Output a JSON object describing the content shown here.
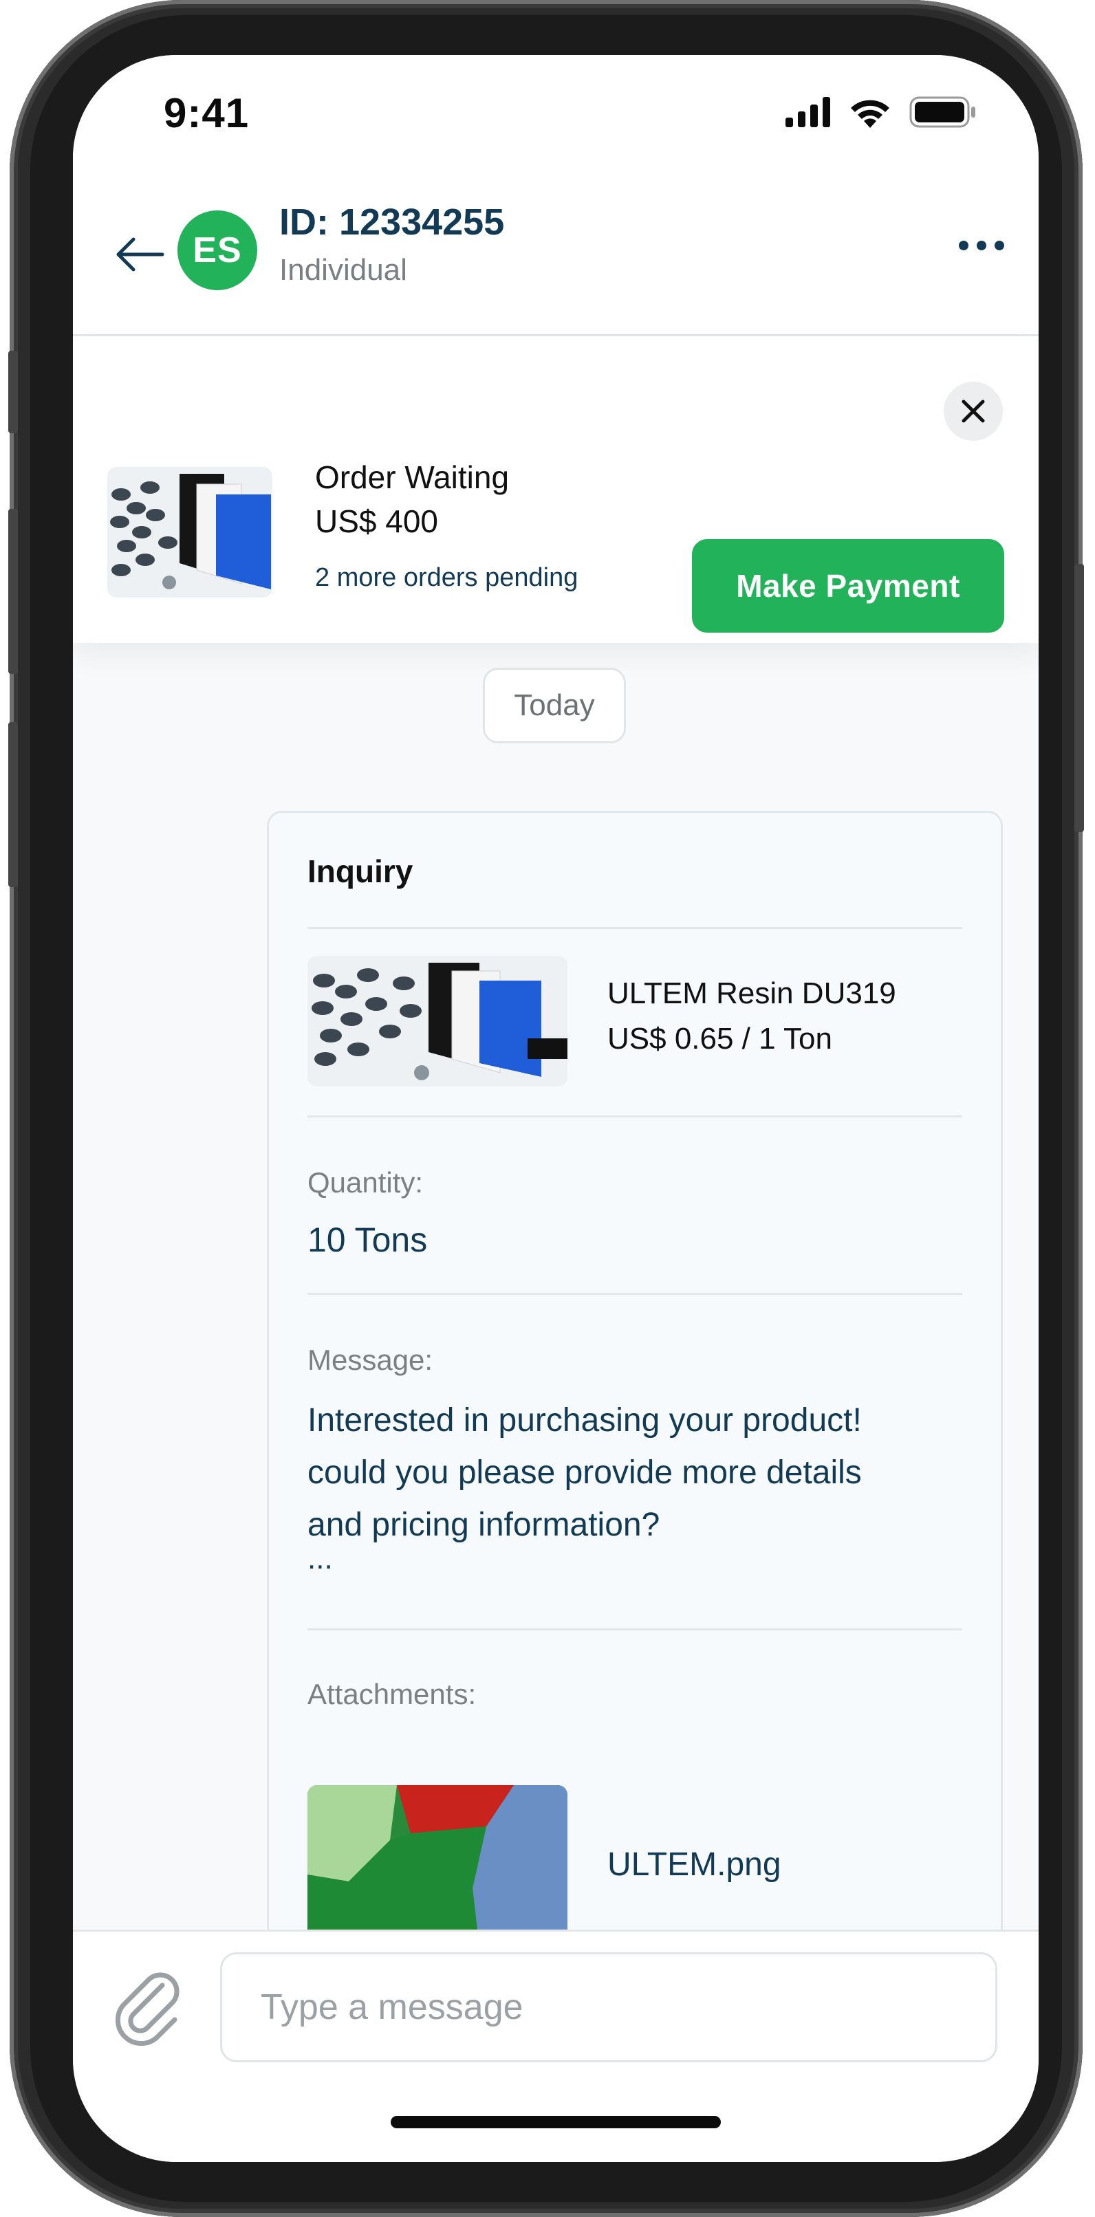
{
  "status_bar": {
    "time": "9:41"
  },
  "header": {
    "avatar_initials": "ES",
    "title": "ID: 12334255",
    "subtitle": "Individual"
  },
  "order_banner": {
    "status": "Order Waiting",
    "amount": "US$ 400",
    "pending_note": "2 more orders pending",
    "button_label": "Make Payment"
  },
  "chat": {
    "date_label": "Today",
    "inquiry": {
      "title": "Inquiry",
      "product": {
        "name": "ULTEM Resin DU319",
        "price": "US$ 0.65 / 1 Ton"
      },
      "quantity_label": "Quantity:",
      "quantity_value": "10 Tons",
      "message_label": "Message:",
      "message_lines": [
        "Interested in purchasing your product!",
        "could you please provide more details",
        "and pricing information?"
      ],
      "message_ellipsis": "...",
      "attachments_label": "Attachments:",
      "attachment_name": "ULTEM.png"
    }
  },
  "composer": {
    "placeholder": "Type a message"
  },
  "colors": {
    "brand_green": "#22b25a",
    "navy_text": "#133a55",
    "muted_text": "#7a7f83"
  },
  "icons": [
    "back-arrow-icon",
    "more-dots-icon",
    "close-icon",
    "paperclip-icon",
    "signal-icon",
    "wifi-icon",
    "battery-icon"
  ]
}
